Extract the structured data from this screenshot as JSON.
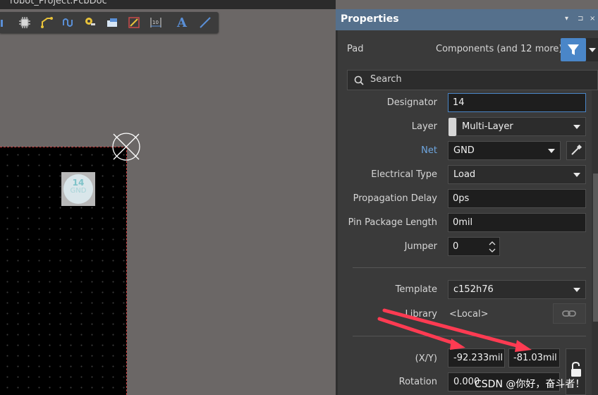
{
  "window": {
    "title": "robot_Project.PcbDoc"
  },
  "toolbar": {
    "tools": [
      "chart-icon",
      "component-icon",
      "route-icon",
      "wave-icon",
      "pin-icon",
      "fill-icon",
      "region-icon",
      "dimension-icon",
      "text-icon",
      "line-icon"
    ],
    "text_tool_glyph": "A"
  },
  "canvas": {
    "pad": {
      "number": "14",
      "net": "GND"
    },
    "colors": {
      "board": "#000000",
      "board_edge": "#c83a3a",
      "background": "#6b6766"
    }
  },
  "panel": {
    "title": "Properties",
    "header_controls": [
      "▾",
      "⊐",
      "×"
    ],
    "object_type": "Pad",
    "filter_summary": "Components (and 12 more)",
    "search_placeholder": "Search",
    "labels": {
      "designator": "Designator",
      "layer": "Layer",
      "net": "Net",
      "electrical_type": "Electrical Type",
      "propagation_delay": "Propagation Delay",
      "pin_package_length": "Pin Package Length",
      "jumper": "Jumper",
      "template": "Template",
      "library": "Library",
      "xy": "(X/Y)",
      "rotation": "Rotation"
    },
    "values": {
      "designator": "14",
      "layer": "Multi-Layer",
      "net": "GND",
      "electrical_type": "Load",
      "propagation_delay": "0ps",
      "pin_package_length": "0mil",
      "jumper": "0",
      "template": "c152h76",
      "library": "<Local>",
      "x": "-92.233mil",
      "y": "-81.03mil",
      "rotation": "0.000"
    },
    "colors": {
      "header": "#55708c",
      "accent": "#4a86c8",
      "annotation_arrow": "#ff3b52"
    }
  },
  "watermark": "CSDN @你好，奋斗者！"
}
